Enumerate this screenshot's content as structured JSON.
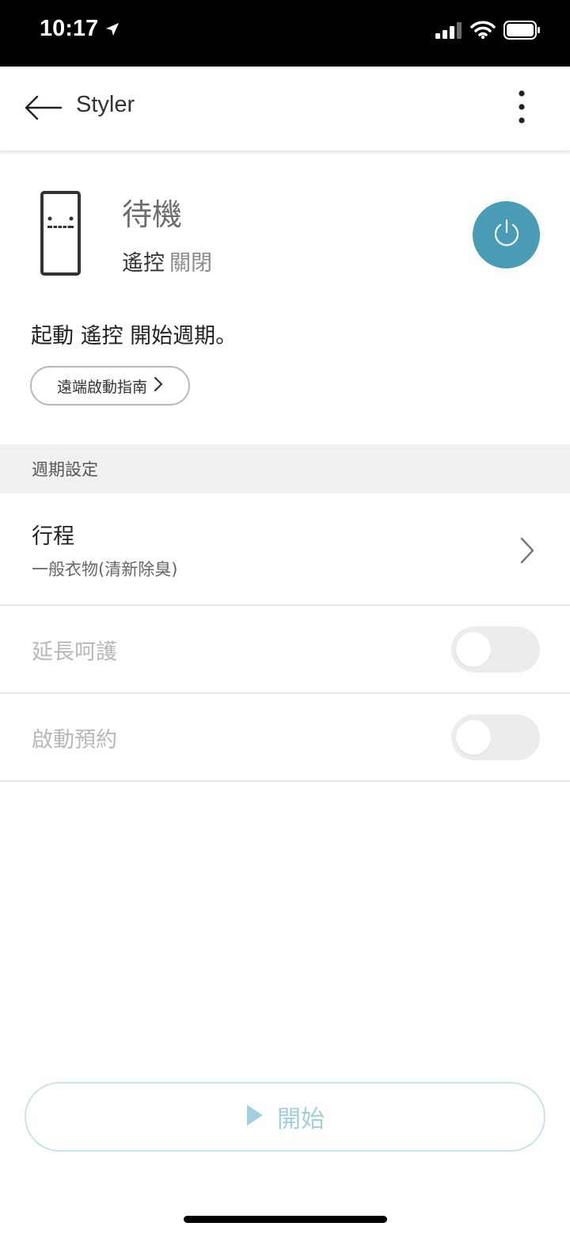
{
  "status_bar": {
    "time": "10:17",
    "icons": [
      "location-arrow-icon",
      "signal-icon",
      "wifi-icon",
      "battery-icon"
    ]
  },
  "app_bar": {
    "title": "Styler",
    "back_icon": "arrow-left-icon",
    "menu_icon": "more-vertical-icon"
  },
  "device": {
    "status": "待機",
    "remote_label": "遙控",
    "remote_value": "關閉",
    "icon": "styler-device-icon",
    "power_icon": "power-icon",
    "power_color": "#4a9bb6"
  },
  "info": {
    "message": "起動 遙控 開始週期。",
    "guide_button": "遠端啟動指南"
  },
  "cycle_settings": {
    "header": "週期設定",
    "course": {
      "title": "行程",
      "value": "一般衣物(清新除臭)"
    },
    "extended_care": {
      "label": "延長呵護",
      "enabled": false
    },
    "reservation": {
      "label": "啟動預約",
      "enabled": false
    }
  },
  "start_button": {
    "label": "開始",
    "icon": "play-icon",
    "color": "#9fd0e0"
  }
}
